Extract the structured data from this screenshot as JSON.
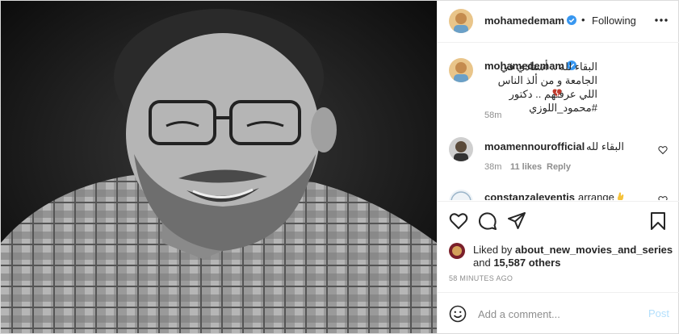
{
  "post": {
    "author": "mohamedemam",
    "follow_dot": "•",
    "follow_label": "Following",
    "caption": "البقاء لله .. أستاذي في الجامعة و من ألذ الناس اللي عرفتهم .. دكتور #محمود_اللوزي",
    "caption_time": "58m"
  },
  "comments": [
    {
      "user": "moamennourofficial",
      "text": "البقاء لله",
      "time": "38m",
      "likes": "11 likes",
      "reply": "Reply"
    },
    {
      "user": "constanzaleventis",
      "text": "arrange"
    }
  ],
  "likes": {
    "prefix": "Liked by",
    "user": "about_new_movies_and_series",
    "and": "and",
    "count": "15,587 others"
  },
  "timestamp": "58 MINUTES AGO",
  "composer": {
    "placeholder": "Add a comment...",
    "post_label": "Post"
  },
  "icons": {
    "verified": "verified-badge-icon",
    "like": "heart-icon",
    "comment": "comment-bubble-icon",
    "share": "paper-plane-icon",
    "save": "bookmark-icon",
    "emoji": "smiley-icon",
    "more": "ellipsis-icon"
  },
  "colors": {
    "verified_blue": "#3897f0",
    "link_blue": "#b2dffc",
    "muted": "#8e8e8e",
    "text": "#262626"
  }
}
